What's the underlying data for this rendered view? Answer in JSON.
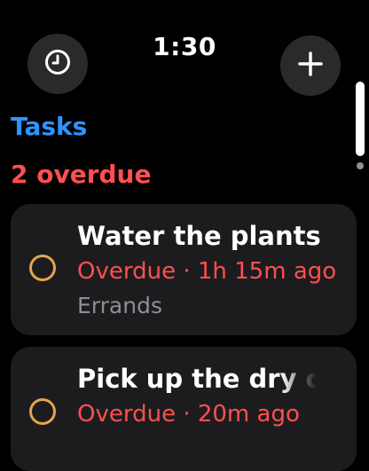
{
  "status_bar": {
    "time": "1:30"
  },
  "toolbar": {
    "history_icon": "clock-icon",
    "add_icon": "plus-icon"
  },
  "header": {
    "title": "Tasks",
    "overdue_summary": "2 overdue"
  },
  "tasks": [
    {
      "title": "Water the plants",
      "status": "Overdue · 1h 15m ago",
      "list": "Errands",
      "completed": false
    },
    {
      "title": "Pick up the dry c",
      "status": "Overdue · 20m ago",
      "completed": false
    }
  ],
  "colors": {
    "accent": "#2f93ff",
    "overdue": "#ff4f4f",
    "checkbox": "#e8a24e",
    "card": "#1c1c1e"
  }
}
